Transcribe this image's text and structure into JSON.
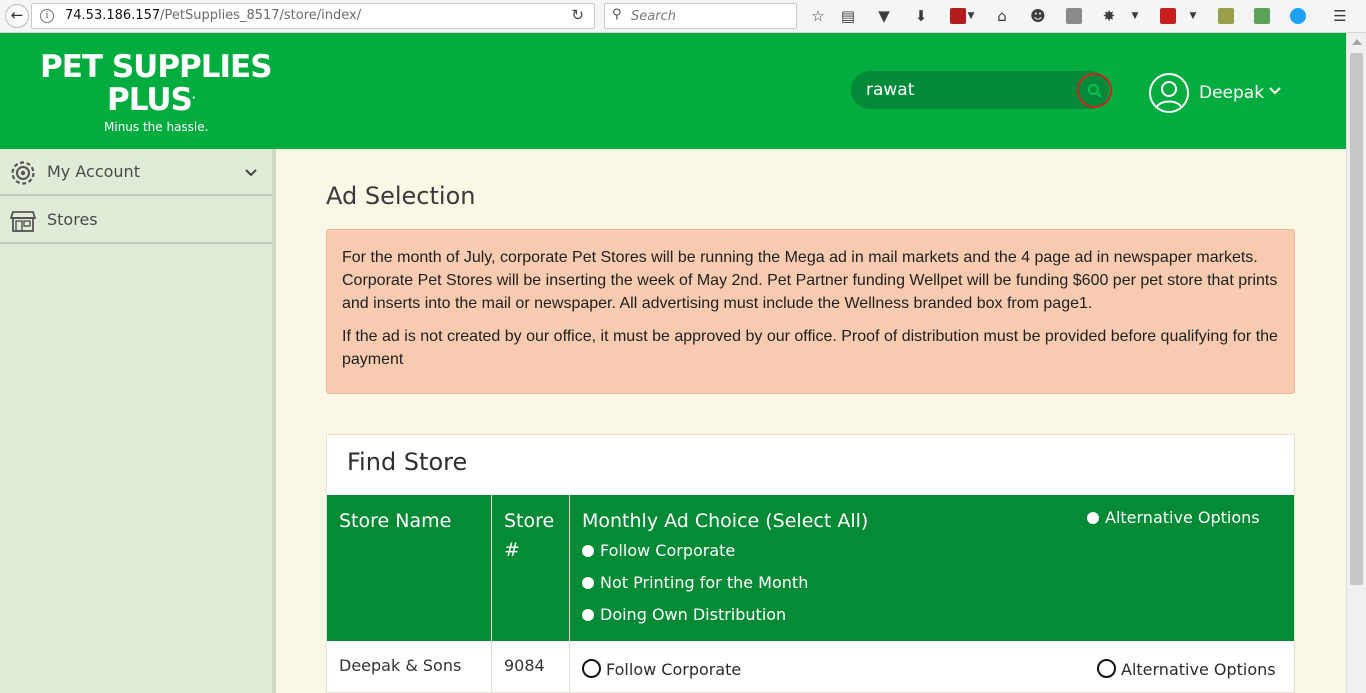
{
  "browser": {
    "url_host": "74.53.186.157",
    "url_path": "/PetSupplies_8517/store/index/",
    "search_placeholder": "Search"
  },
  "brand": {
    "line1": "PET SUPPLIES",
    "line2": "PLUS",
    "reg_mark": ".",
    "tagline": "Minus the hassle.",
    "color_primary": "#03ac3f",
    "color_dark": "#058a36"
  },
  "header": {
    "search_value": "rawat",
    "user_name": "Deepak"
  },
  "sidebar": {
    "items": [
      {
        "label": "My Account",
        "icon": "gear-icon",
        "has_caret": true
      },
      {
        "label": "Stores",
        "icon": "store-icon",
        "has_caret": false
      }
    ]
  },
  "page": {
    "title": "Ad Selection",
    "notice_p1": "For the month of July, corporate Pet Stores will be running the Mega ad in mail markets and the 4 page ad in newspaper markets. Corporate Pet Stores will be inserting the week of May 2nd. Pet Partner funding Wellpet will be funding $600 per pet store that prints and inserts into the mail or newspaper. All advertising must include the Wellness branded box from page1.",
    "notice_p2": "If the ad is not created by our office, it must be approved by our office. Proof of distribution must be provided before qualifying for the payment"
  },
  "find_store": {
    "title": "Find Store",
    "columns": {
      "store_name": "Store Name",
      "store_num": "Store #",
      "ad_choice": "Monthly Ad Choice (Select All)"
    },
    "header_options": [
      "Follow Corporate",
      "Not Printing for the Month",
      "Doing Own Distribution"
    ],
    "header_alt": "Alternative Options",
    "rows": [
      {
        "store_name": "Deepak & Sons",
        "store_num": "9084",
        "opt1": "Follow Corporate",
        "alt": "Alternative Options"
      }
    ]
  }
}
